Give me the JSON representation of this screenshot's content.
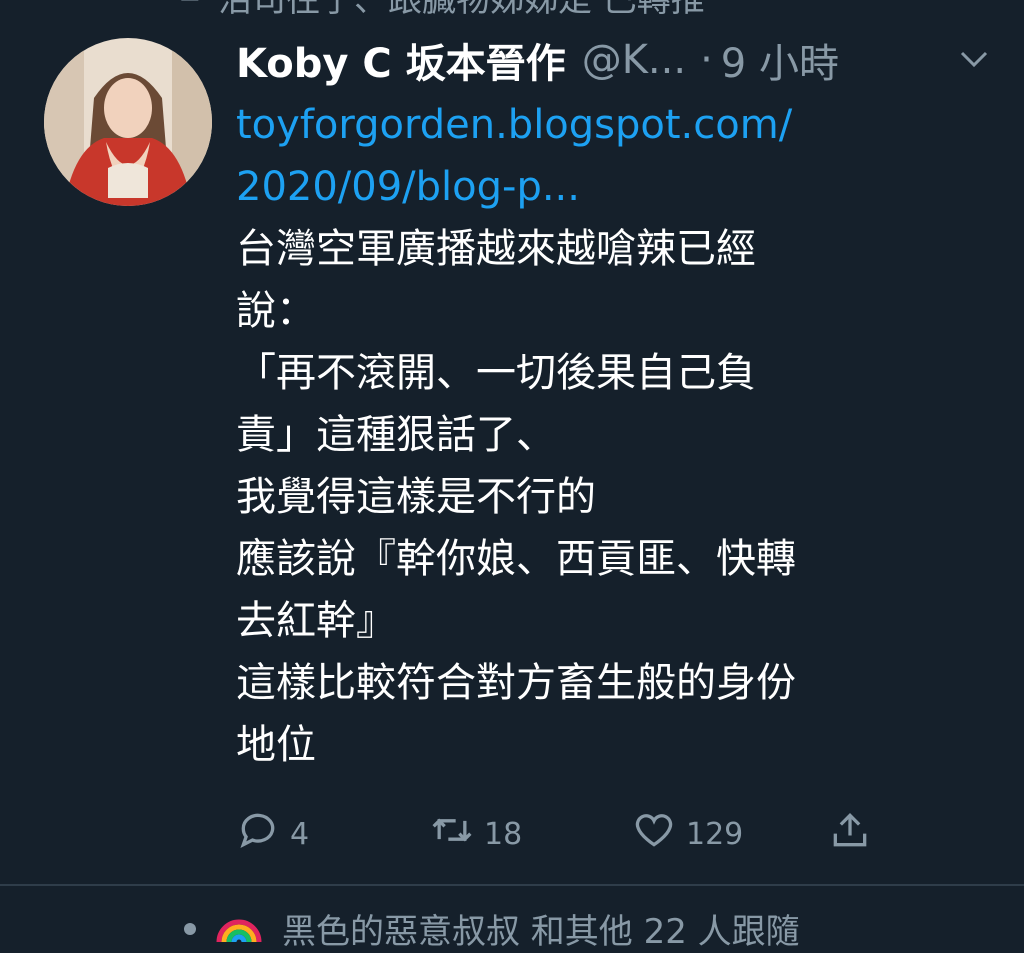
{
  "context_top": {
    "icon": "retweet-icon",
    "text": "沼司往子、跟臓物姊姊是 已轉推"
  },
  "tweet": {
    "display_name": "Koby C 坂本晉作",
    "handle": "@K...",
    "separator": "·",
    "time": "9 小時",
    "link_line1": "toyforgorden.blogspot.com/",
    "link_line2": "2020/09/blog-p...",
    "text": "台灣空軍廣播越來越嗆辣已經\n說：\n「再不滾開、一切後果自己負\n責」這種狠話了、\n我覺得這樣是不行的\n應該說『幹你娘、西貢匪、快轉\n去紅幹』\n這樣比較符合對方畜生般的身份\n地位"
  },
  "actions": {
    "reply_count": "4",
    "retweet_count": "18",
    "like_count": "129"
  },
  "context_bottom": {
    "icon": "rainbow-icon",
    "text": "黑色的惡意叔叔 和其他 22 人跟隨"
  },
  "colors": {
    "background": "#15202b",
    "link": "#1da1f2",
    "muted": "#8899a6"
  }
}
